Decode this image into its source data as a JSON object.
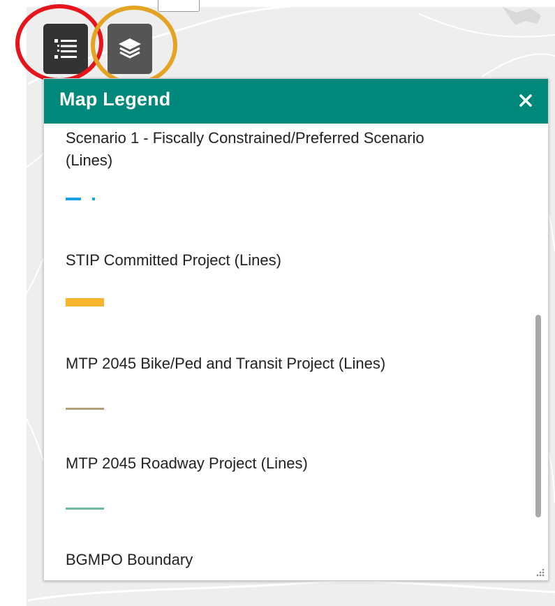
{
  "toolbar": {
    "legend_button_icon": "legend-list-icon",
    "layers_button_icon": "layers-stack-icon"
  },
  "annotations": {
    "legend_ring_color": "#e8141c",
    "layers_ring_color": "#e4a323"
  },
  "legend": {
    "title": "Map Legend",
    "close_label": "×",
    "header_color": "#00897b",
    "items": [
      {
        "label_line1": "Scenario 1 - Fiscally Constrained/Preferred Scenario",
        "label_line2": "(Lines)",
        "symbol": "dash-dot",
        "color": "#1ea0e6"
      },
      {
        "label": "STIP Committed Project (Lines)",
        "symbol": "thick-line",
        "color": "#f7b42c"
      },
      {
        "label": "MTP 2045 Bike/Ped and Transit Project (Lines)",
        "symbol": "line",
        "color": "#b0a07a"
      },
      {
        "label": "MTP 2045 Roadway Project (Lines)",
        "symbol": "line",
        "color": "#6fb8a0"
      },
      {
        "label": "BGMPO Boundary",
        "symbol": "none",
        "color": ""
      }
    ]
  }
}
